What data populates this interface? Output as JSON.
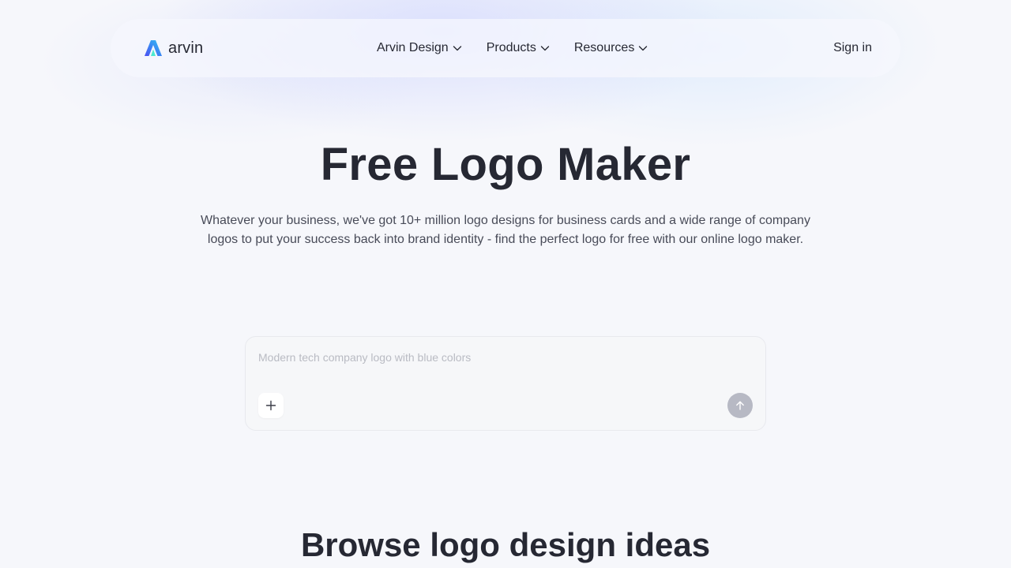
{
  "header": {
    "brand_name": "arvin",
    "nav": [
      {
        "label": "Arvin Design"
      },
      {
        "label": "Products"
      },
      {
        "label": "Resources"
      }
    ],
    "sign_in_label": "Sign in"
  },
  "hero": {
    "title": "Free Logo Maker",
    "subtitle": "Whatever your business, we've got 10+ million logo designs for business cards and a wide range of company logos to put your success back into brand identity - find the perfect logo for free with our online logo maker."
  },
  "prompt": {
    "placeholder": "Modern tech company logo with blue colors",
    "value": ""
  },
  "browse": {
    "title": "Browse logo design ideas"
  },
  "colors": {
    "text_primary": "#262833",
    "send_button": "#b7b9c4",
    "logo_gradient_start": "#35c2f0",
    "logo_gradient_end": "#4a4ef2"
  },
  "icons": {
    "logo": "arvin-logo-icon",
    "chevron": "chevron-down-icon",
    "add": "plus-icon",
    "send": "arrow-up-icon"
  }
}
